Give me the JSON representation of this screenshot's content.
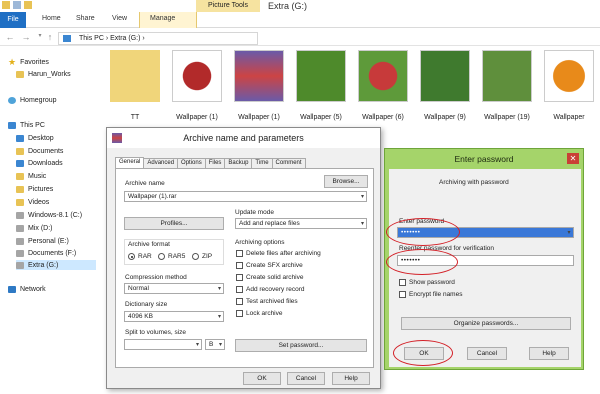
{
  "window": {
    "title": "Extra (G:)",
    "context_tab": "Picture Tools"
  },
  "ribbon": {
    "file": "File",
    "tabs": [
      "Home",
      "Share",
      "View"
    ],
    "manage": "Manage"
  },
  "address": {
    "path": "This PC  ›  Extra (G:)  ›"
  },
  "nav": {
    "favorites": "Favorites",
    "harun": "Harun_Works",
    "homegroup": "Homegroup",
    "thispc": "This PC",
    "desktop": "Desktop",
    "documents": "Documents",
    "downloads": "Downloads",
    "music": "Music",
    "pictures": "Pictures",
    "videos": "Videos",
    "windows": "Windows-8.1 (C:)",
    "mix": "Mix (D:)",
    "personal": "Personal (E:)",
    "documentsf": "Documents (F:)",
    "extra": "Extra (G:)",
    "network": "Network"
  },
  "thumbnails": [
    {
      "caption": "TT",
      "color": "#f0d57a"
    },
    {
      "caption": "Wallpaper (1)",
      "color": "#b22a2a"
    },
    {
      "caption": "Wallpaper (1)",
      "color": "#6a5aa8"
    },
    {
      "caption": "Wallpaper (5)",
      "color": "#4e8a2b"
    },
    {
      "caption": "Wallpaper (6)",
      "color": "#c73a3a"
    },
    {
      "caption": "Wallpaper (9)",
      "color": "#3f7a2e"
    },
    {
      "caption": "Wallpaper (19)",
      "color": "#5f8f3c"
    },
    {
      "caption": "Wallpaper",
      "color": "#e88a1a"
    }
  ],
  "archive": {
    "title": "Archive name and parameters",
    "tabs": [
      "General",
      "Advanced",
      "Options",
      "Files",
      "Backup",
      "Time",
      "Comment"
    ],
    "archive_name_label": "Archive name",
    "browse": "Browse...",
    "archive_name_value": "Wallpaper (1).rar",
    "profiles": "Profiles...",
    "update_mode_label": "Update mode",
    "update_mode_value": "Add and replace files",
    "archive_format_label": "Archive format",
    "formats": [
      "RAR",
      "RAR5",
      "ZIP"
    ],
    "compression_label": "Compression method",
    "compression_value": "Normal",
    "dictionary_label": "Dictionary size",
    "dictionary_value": "4096 KB",
    "split_label": "Split to volumes, size",
    "split_unit": "B",
    "archiving_options_label": "Archiving options",
    "options": [
      "Delete files after archiving",
      "Create SFX archive",
      "Create solid archive",
      "Add recovery record",
      "Test archived files",
      "Lock archive"
    ],
    "set_password": "Set password...",
    "ok": "OK",
    "cancel": "Cancel",
    "help": "Help"
  },
  "password": {
    "title": "Enter password",
    "subtitle": "Archiving with password",
    "enter_label": "Enter password",
    "enter_value": "•••••••",
    "reenter_label": "Reenter password for verification",
    "reenter_value": "•••••••",
    "show_password": "Show password",
    "encrypt_names": "Encrypt file names",
    "organize": "Organize passwords...",
    "ok": "OK",
    "cancel": "Cancel",
    "help": "Help",
    "close": "✕"
  }
}
